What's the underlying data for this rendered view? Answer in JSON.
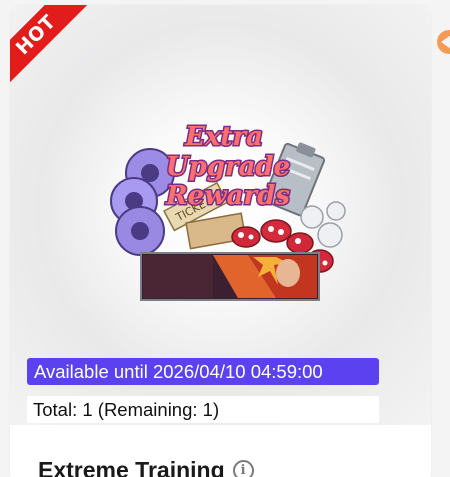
{
  "badge": {
    "label": "HOT"
  },
  "item_image": {
    "alt": "Extra Upgrade Rewards",
    "logo_text": [
      "Extra",
      "Upgrade",
      "Rewards"
    ],
    "ticket_text": "TICKE"
  },
  "availability": {
    "text": "Available until 2026/04/10 04:59:00"
  },
  "stock": {
    "text": "Total: 1 (Remaining: 1)"
  },
  "product": {
    "title": "Extreme Training",
    "info_symbol": "i"
  },
  "colors": {
    "badge_red": "#e21b1b",
    "availability_purple": "#5b41ef",
    "nav_orange": "#f59a56"
  },
  "icons": {
    "info": "info-circle-icon",
    "nav": "next-arrow-icon"
  }
}
